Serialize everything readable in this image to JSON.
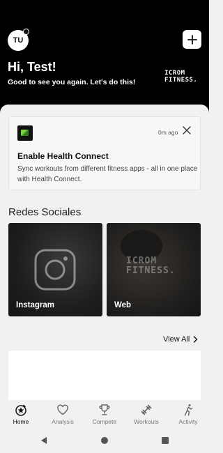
{
  "header": {
    "avatar_initials": "TU",
    "greeting": "Hi, Test!",
    "subtitle": "Good to see you again. Let's do this!",
    "logo_line1": "ICROM",
    "logo_line2": "FITNESS."
  },
  "health_card": {
    "time": "0m ago",
    "title": "Enable Health Connect",
    "description": "Sync workouts from different fitness apps - all in one place with Health Connect."
  },
  "social": {
    "section_title": "Redes Sociales",
    "items": [
      {
        "label": "Instagram"
      },
      {
        "label": "Web"
      }
    ],
    "web_logo_line1": "ICROM",
    "web_logo_line2": "FITNESS."
  },
  "view_all": "View All",
  "nav": {
    "items": [
      {
        "label": "Home",
        "icon": "home-icon",
        "active": true
      },
      {
        "label": "Analysis",
        "icon": "heart-icon",
        "active": false
      },
      {
        "label": "Compete",
        "icon": "trophy-icon",
        "active": false
      },
      {
        "label": "Workouts",
        "icon": "dumbbell-icon",
        "active": false
      },
      {
        "label": "Activity",
        "icon": "activity-icon",
        "active": false
      }
    ]
  },
  "colors": {
    "header_bg": "#000000",
    "background": "#f1f1f1",
    "text_primary": "#111111",
    "nav_inactive": "#777777"
  }
}
